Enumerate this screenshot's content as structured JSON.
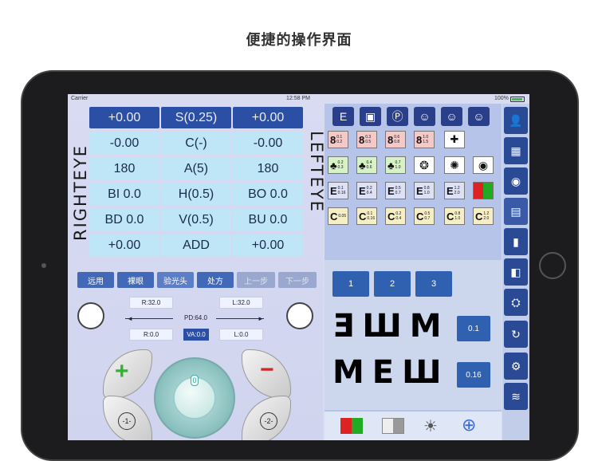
{
  "caption": "便捷的操作界面",
  "status": {
    "carrier": "Carrier",
    "time": "12:58 PM",
    "battery": "100%"
  },
  "labels": {
    "right_eye": "RIGHTEYE",
    "left_eye": "LEFTEYE"
  },
  "grid": {
    "row1": [
      "+0.00",
      "S(0.25)",
      "+0.00"
    ],
    "row2": [
      "-0.00",
      "C(-)",
      "-0.00"
    ],
    "row3": [
      "180",
      "A(5)",
      "180"
    ],
    "row4": [
      "BI 0.0",
      "H(0.5)",
      "BO 0.0"
    ],
    "row5": [
      "BD 0.0",
      "V(0.5)",
      "BU 0.0"
    ],
    "row6": [
      "+0.00",
      "ADD",
      "+0.00"
    ]
  },
  "modes": [
    "远用",
    "裸眼",
    "验光头",
    "处方",
    "上一步",
    "下一步"
  ],
  "pd": {
    "r_top": "R:32.0",
    "l_top": "L:32.0",
    "pd": "PD:64.0",
    "r_bot": "R:0.0",
    "va": "VA:0.0",
    "l_bot": "L:0.0"
  },
  "controls": {
    "plus": "+",
    "minus": "−",
    "one": "-1-",
    "two": "-2-",
    "dial_value": "0"
  },
  "charts": {
    "row1": [
      {
        "glyph": "8",
        "v": "0.1",
        "w": "0.2",
        "bg": "#f6c9c9"
      },
      {
        "glyph": "8",
        "v": "0.3",
        "w": "0.5",
        "bg": "#f6c9c9"
      },
      {
        "glyph": "8",
        "v": "0.6",
        "w": "0.8",
        "bg": "#f6c9c9"
      },
      {
        "glyph": "8",
        "v": "1.0",
        "w": "1.5",
        "bg": "#f6c9c9"
      }
    ],
    "row2": [
      {
        "glyph": "♣",
        "v": "0.2",
        "w": "0.3",
        "bg": "#d6f2c6"
      },
      {
        "glyph": "♣",
        "v": "0.4",
        "w": "0.6",
        "bg": "#d6f2c6"
      },
      {
        "glyph": "♣",
        "v": "0.7",
        "w": "1.0",
        "bg": "#d6f2c6"
      }
    ],
    "row3": [
      {
        "glyph": "E",
        "v": "0.1",
        "w": "0.16",
        "bg": "#dde1f6"
      },
      {
        "glyph": "E",
        "v": "0.2",
        "w": "0.4",
        "bg": "#dde1f6"
      },
      {
        "glyph": "E",
        "v": "0.5",
        "w": "0.7",
        "bg": "#dde1f6"
      },
      {
        "glyph": "E",
        "v": "0.8",
        "w": "1.0",
        "bg": "#dde1f6"
      },
      {
        "glyph": "E",
        "v": "1.2",
        "w": "2.0",
        "bg": "#dde1f6"
      }
    ],
    "row4": [
      {
        "glyph": "C",
        "v": "0.05",
        "w": "",
        "bg": "#f6efc6"
      },
      {
        "glyph": "C",
        "v": "0.1",
        "w": "0.16",
        "bg": "#f6efc6"
      },
      {
        "glyph": "C",
        "v": "0.2",
        "w": "0.4",
        "bg": "#f6efc6"
      },
      {
        "glyph": "C",
        "v": "0.5",
        "w": "0.7",
        "bg": "#f6efc6"
      },
      {
        "glyph": "C",
        "v": "0.8",
        "w": "1.0",
        "bg": "#f6efc6"
      },
      {
        "glyph": "C",
        "v": "1.2",
        "w": "2.0",
        "bg": "#f6efc6"
      }
    ]
  },
  "numbers": [
    "1",
    "2",
    "3"
  ],
  "letter_rows": [
    "ƎШM",
    "MEШ"
  ],
  "va_values": [
    "0.1",
    "0.16"
  ]
}
